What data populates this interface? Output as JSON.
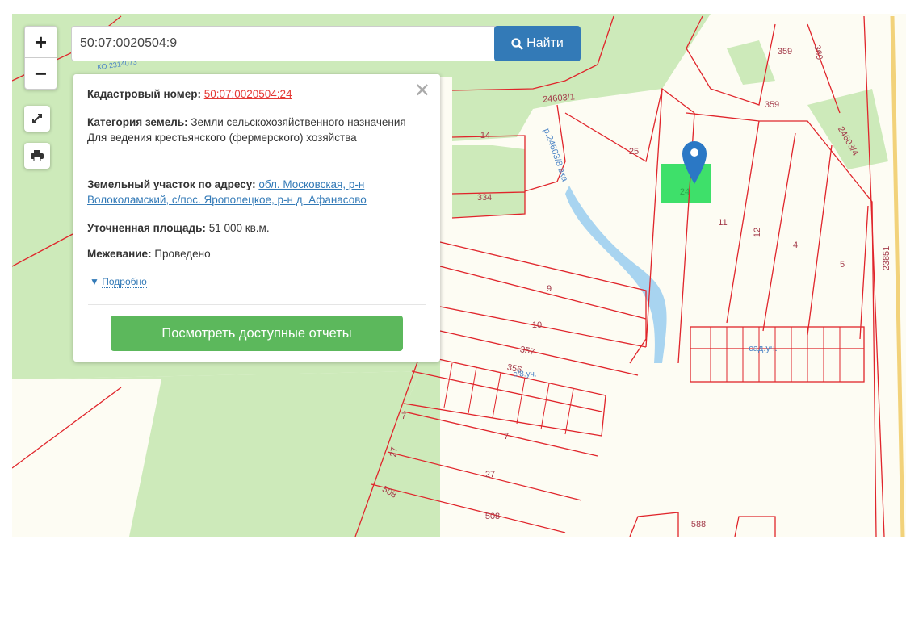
{
  "search": {
    "value": "50:07:0020504:9",
    "button_label": "Найти"
  },
  "controls": {
    "zoom_in": "+",
    "zoom_out": "−"
  },
  "popup": {
    "cad_label": "Кадастровый номер:",
    "cad_value": "50:07:0020504:24",
    "cat_label": "Категория земель:",
    "cat_value": "Земли сельскохозяйственного назначения",
    "usage": "Для ведения крестьянского (фермерского) хозяйства",
    "addr_label": "Земельный участок по адресу:",
    "addr_value": "обл. Московская, р-н Волоколамский, с/пос. Ярополецкое, р-н д. Афанасово",
    "area_label": "Уточненная площадь:",
    "area_value": "51 000 кв.м.",
    "survey_label": "Межевание:",
    "survey_value": "Проведено",
    "more": "Подробно",
    "reports_button": "Посмотреть доступные отчеты"
  },
  "map_labels": [
    "14",
    "334",
    "24603/1",
    "р.24603/8 вка",
    "25",
    "24",
    "11",
    "12",
    "4",
    "5",
    "23851",
    "359",
    "360",
    "359",
    "24603/4",
    "9",
    "10",
    "357",
    "356",
    "7",
    "7",
    "27",
    "27",
    "508",
    "508",
    "588",
    "сад.уч.",
    "КО 2314073",
    "с/8.уч."
  ],
  "colors": {
    "accent": "#337ab7",
    "success": "#5cb85c",
    "parcel": "#e0252b",
    "selected": "#3ee06a",
    "forest": "#cdeaba",
    "water": "#a8d4f0"
  }
}
